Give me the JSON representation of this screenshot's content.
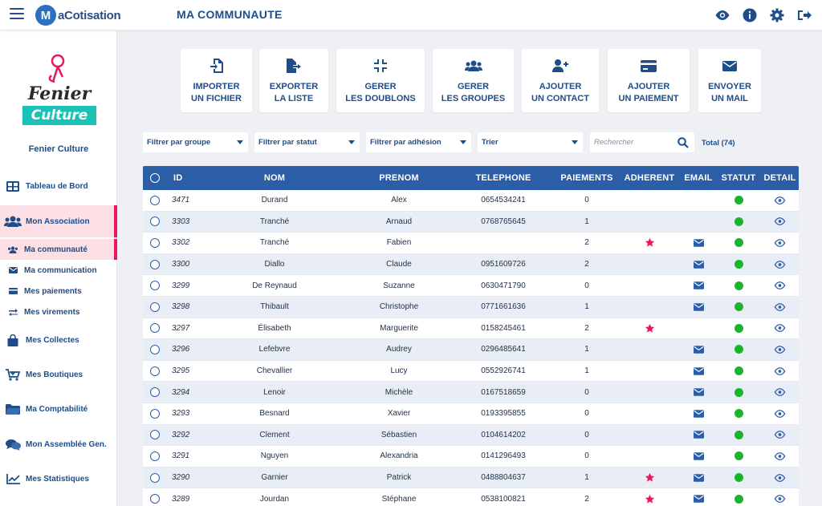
{
  "app": {
    "brand_mark": "M",
    "brand_text": "aCotisation",
    "page_title": "MA COMMUNAUTE"
  },
  "colors": {
    "primary": "#2c5ea8",
    "accent": "#e8185a",
    "status_green": "#19b52b",
    "star_red": "#e8185a"
  },
  "topbar_icons": [
    "eye-icon",
    "info-icon",
    "gear-icon",
    "logout-icon"
  ],
  "sidebar": {
    "org_logo_line1": "Fenier",
    "org_logo_line2": "Culture",
    "org_name": "Fenier Culture",
    "items": [
      {
        "label": "Tableau de Bord",
        "icon": "dashboard-icon"
      },
      {
        "label": "Mon Association",
        "icon": "users-icon",
        "active": true
      },
      {
        "label": "Ma communauté",
        "icon": "users-small-icon",
        "sub": true,
        "active": true
      },
      {
        "label": "Ma communication",
        "icon": "envelope-icon",
        "sub": true
      },
      {
        "label": "Mes paiements",
        "icon": "card-icon",
        "sub": true
      },
      {
        "label": "Mes virements",
        "icon": "transfer-icon",
        "sub": true
      },
      {
        "label": "Mes Collectes",
        "icon": "bag-icon"
      },
      {
        "label": "Mes Boutiques",
        "icon": "cart-icon"
      },
      {
        "label": "Ma Comptabilité",
        "icon": "folder-icon"
      },
      {
        "label": "Mon Assemblée Gen.",
        "icon": "comments-icon"
      },
      {
        "label": "Mes Statistiques",
        "icon": "chart-icon"
      }
    ]
  },
  "actions": [
    {
      "label": "IMPORTER\nUN FICHIER",
      "icon": "file-import-icon"
    },
    {
      "label": "EXPORTER\nLA LISTE",
      "icon": "file-export-icon"
    },
    {
      "label": "GERER\nLES DOUBLONS",
      "icon": "compress-icon"
    },
    {
      "label": "GERER\nLES GROUPES",
      "icon": "group-icon"
    },
    {
      "label": "AJOUTER\nUN CONTACT",
      "icon": "user-plus-icon"
    },
    {
      "label": "AJOUTER\nUN PAIEMENT",
      "icon": "credit-card-icon"
    },
    {
      "label": "ENVOYER\nUN MAIL",
      "icon": "mail-icon"
    }
  ],
  "filters": {
    "group": "Filtrer par groupe",
    "status": "Filtrer par statut",
    "membership": "Filtrer par adhésion",
    "sort": "Trier",
    "search_placeholder": "Rechercher",
    "total": "Total (74)"
  },
  "table": {
    "headers": {
      "id": "ID",
      "nom": "NOM",
      "prenom": "PRENOM",
      "telephone": "TELEPHONE",
      "paiements": "PAIEMENTS",
      "adherent": "ADHERENT",
      "email": "EMAIL",
      "statut": "STATUT",
      "detail": "DETAIL"
    },
    "rows": [
      {
        "id": "3471",
        "nom": "Durand",
        "prenom": "Alex",
        "telephone": "0654534241",
        "paiements": "0",
        "adherent": false,
        "email": false,
        "statut": "active"
      },
      {
        "id": "3303",
        "nom": "Tranché",
        "prenom": "Arnaud",
        "telephone": "0768765645",
        "paiements": "1",
        "adherent": false,
        "email": false,
        "statut": "active"
      },
      {
        "id": "3302",
        "nom": "Tranché",
        "prenom": "Fabien",
        "telephone": "",
        "paiements": "2",
        "adherent": true,
        "email": true,
        "statut": "active"
      },
      {
        "id": "3300",
        "nom": "Diallo",
        "prenom": "Claude",
        "telephone": "0951609726",
        "paiements": "2",
        "adherent": false,
        "email": true,
        "statut": "active"
      },
      {
        "id": "3299",
        "nom": "De Reynaud",
        "prenom": "Suzanne",
        "telephone": "0630471790",
        "paiements": "0",
        "adherent": false,
        "email": true,
        "statut": "active"
      },
      {
        "id": "3298",
        "nom": "Thibault",
        "prenom": "Christophe",
        "telephone": "0771661636",
        "paiements": "1",
        "adherent": false,
        "email": true,
        "statut": "active"
      },
      {
        "id": "3297",
        "nom": "Élisabeth",
        "prenom": "Marguerite",
        "telephone": "0158245461",
        "paiements": "2",
        "adherent": true,
        "email": false,
        "statut": "active"
      },
      {
        "id": "3296",
        "nom": "Lefebvre",
        "prenom": "Audrey",
        "telephone": "0296485641",
        "paiements": "1",
        "adherent": false,
        "email": true,
        "statut": "active"
      },
      {
        "id": "3295",
        "nom": "Chevallier",
        "prenom": "Lucy",
        "telephone": "0552926741",
        "paiements": "1",
        "adherent": false,
        "email": true,
        "statut": "active"
      },
      {
        "id": "3294",
        "nom": "Lenoir",
        "prenom": "Michèle",
        "telephone": "0167518659",
        "paiements": "0",
        "adherent": false,
        "email": true,
        "statut": "active"
      },
      {
        "id": "3293",
        "nom": "Besnard",
        "prenom": "Xavier",
        "telephone": "0193395855",
        "paiements": "0",
        "adherent": false,
        "email": true,
        "statut": "active"
      },
      {
        "id": "3292",
        "nom": "Clement",
        "prenom": "Sébastien",
        "telephone": "0104614202",
        "paiements": "0",
        "adherent": false,
        "email": true,
        "statut": "active"
      },
      {
        "id": "3291",
        "nom": "Nguyen",
        "prenom": "Alexandria",
        "telephone": "0141296493",
        "paiements": "0",
        "adherent": false,
        "email": true,
        "statut": "active"
      },
      {
        "id": "3290",
        "nom": "Garnier",
        "prenom": "Patrick",
        "telephone": "0488804637",
        "paiements": "1",
        "adherent": true,
        "email": true,
        "statut": "active"
      },
      {
        "id": "3289",
        "nom": "Jourdan",
        "prenom": "Stéphane",
        "telephone": "0538100821",
        "paiements": "2",
        "adherent": true,
        "email": true,
        "statut": "active"
      }
    ]
  }
}
